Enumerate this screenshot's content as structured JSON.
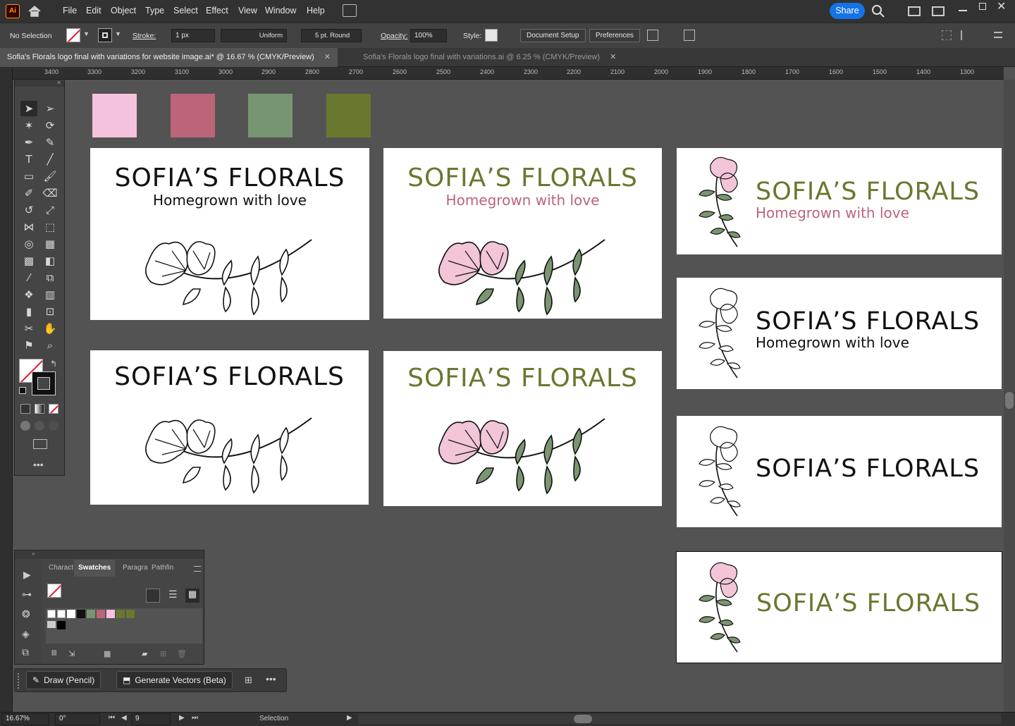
{
  "menu": {
    "items": [
      "File",
      "Edit",
      "Object",
      "Type",
      "Select",
      "Effect",
      "View",
      "Window",
      "Help"
    ],
    "share": "Share"
  },
  "control": {
    "selection": "No Selection",
    "stroke_label": "Stroke:",
    "stroke_value": "1 px",
    "profile": "Uniform",
    "brush": "5 pt. Round",
    "opacity_label": "Opacity:",
    "opacity": "100%",
    "style_label": "Style:",
    "doc_setup": "Document Setup",
    "preferences": "Preferences"
  },
  "tabs": [
    {
      "label": "Sofia's Florals logo final with variations for website image.ai* @ 16.67 % (CMYK/Preview)"
    },
    {
      "label": "Sofia's Florals logo final with variations.ai @ 6.25 % (CMYK/Preview)"
    }
  ],
  "ruler": {
    "ticks": [
      "3400",
      "3300",
      "3200",
      "3100",
      "3000",
      "2900",
      "2800",
      "2700",
      "2600",
      "2500",
      "2400",
      "2300",
      "2200",
      "2100",
      "2000",
      "1900",
      "1800",
      "1700",
      "1600",
      "1500",
      "1400",
      "1300"
    ]
  },
  "colors": {
    "pink": "#f4c2db",
    "rose": "#bc6479",
    "sage": "#789572",
    "olive": "#69782f",
    "petal": "#f2c5d8",
    "leaf": "#7a9670"
  },
  "logo": {
    "name": "SOFIA’S FLORALS",
    "tagline": "Homegrown with love"
  },
  "swatches_panel": {
    "tabs": [
      "Charact",
      "Swatches",
      "Paragra",
      "Pathfin"
    ]
  },
  "bottom": {
    "draw": "Draw (Pencil)",
    "generate": "Generate Vectors (Beta)"
  },
  "status": {
    "zoom": "16.67%",
    "rotation": "0°",
    "artboard": "9",
    "tool": "Selection"
  }
}
